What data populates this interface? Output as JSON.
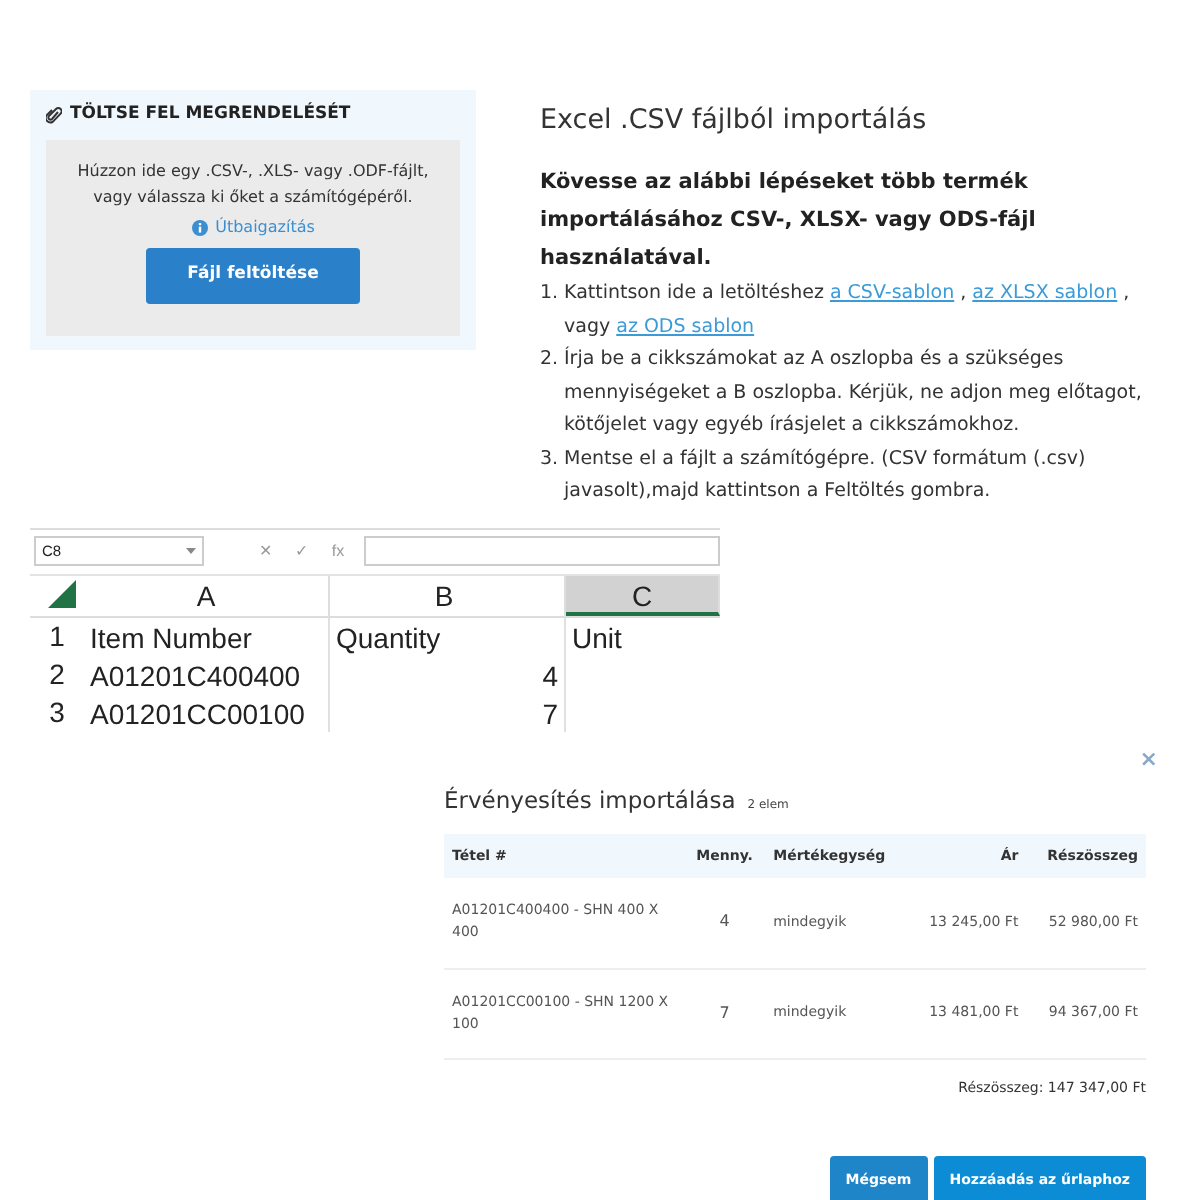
{
  "upload": {
    "title": "TÖLTSE FEL MEGRENDELÉSÉT",
    "description": "Húzzon ide egy .CSV-, .XLS- vagy .ODF-fájlt, vagy válassza ki őket a számítógépéről.",
    "help_link": "Útbaigazítás",
    "button": "Fájl feltöltése"
  },
  "instructions": {
    "title": "Excel .CSV fájlból importálás",
    "intro": "Kövesse az alábbi lépéseket több termék importálásához CSV-, XLSX- vagy ODS-fájl használatával.",
    "steps": [
      {
        "number": "1.",
        "parts": [
          {
            "kind": "text",
            "text": "Kattintson ide a letöltéshez "
          },
          {
            "kind": "link",
            "text": "a CSV-sablon"
          },
          {
            "kind": "text",
            "text": " , "
          },
          {
            "kind": "link",
            "text": "az XLSX sablon"
          },
          {
            "kind": "text",
            "text": " , vagy "
          },
          {
            "kind": "link",
            "text": "az ODS sablon"
          }
        ]
      },
      {
        "number": "2.",
        "parts": [
          {
            "kind": "text",
            "text": "Írja be a cikkszámokat az A oszlopba és a szükséges mennyiségeket a B oszlopba. Kérjük, ne adjon meg előtagot, kötőjelet vagy egyéb írásjelet a cikkszámokhoz."
          }
        ]
      },
      {
        "number": "3.",
        "parts": [
          {
            "kind": "text",
            "text": "Mentse el a fájlt a számítógépre. (CSV formátum (.csv) javasolt),majd kattintson a Feltöltés gombra."
          }
        ]
      }
    ]
  },
  "spreadsheet": {
    "name_box": "C8",
    "formula_buttons": [
      "✕",
      "✓",
      "fx"
    ],
    "columns": [
      {
        "label": "A",
        "selected": false
      },
      {
        "label": "B",
        "selected": false
      },
      {
        "label": "C",
        "selected": true
      }
    ],
    "rows": [
      {
        "number": "1",
        "cells": [
          "Item Number",
          "Quantity",
          "Unit"
        ]
      },
      {
        "number": "2",
        "cells": [
          "A01201C400400",
          "4",
          ""
        ]
      },
      {
        "number": "3",
        "cells": [
          "A01201CC00100",
          "7",
          ""
        ]
      }
    ]
  },
  "modal": {
    "close": "×",
    "title": "Érvényesítés importálása",
    "count": "2 elem",
    "columns": [
      "Tétel #",
      "Menny.",
      "Mértékegység",
      "Ár",
      "Részösszeg"
    ],
    "rows": [
      [
        "A01201C400400 - SHN 400 X 400",
        "4",
        "mindegyik",
        "13 245,00 Ft",
        "52 980,00 Ft"
      ],
      [
        "A01201CC00100 - SHN 1200 X 100",
        "7",
        "mindegyik",
        "13 481,00 Ft",
        "94 367,00 Ft"
      ]
    ],
    "subtotal": "Részösszeg: 147 347,00 Ft",
    "buttons": [
      "Mégsem",
      "Hozzáadás az űrlaphoz"
    ]
  }
}
